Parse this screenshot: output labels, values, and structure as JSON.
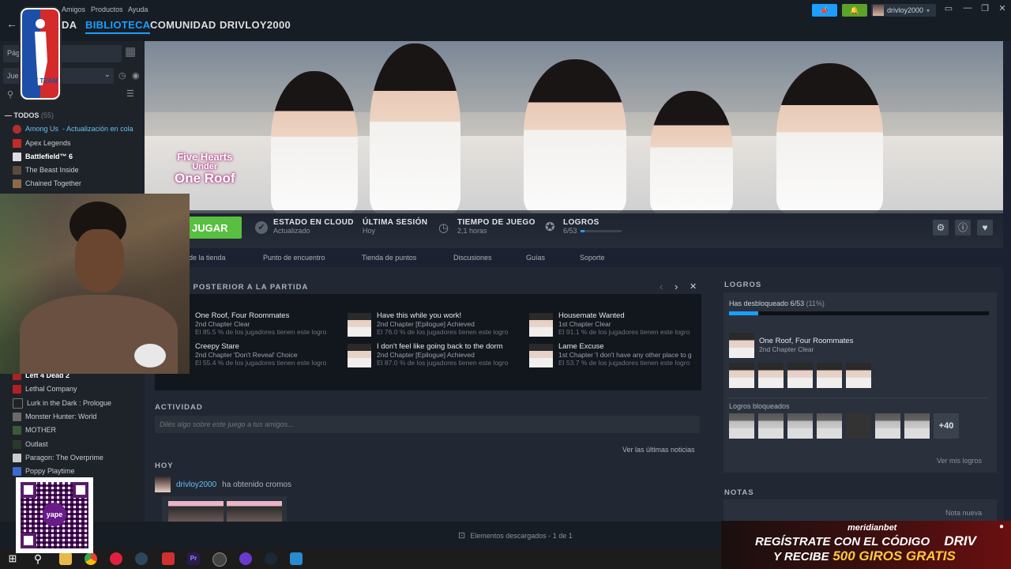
{
  "topbar": {
    "menu": [
      "Amigos",
      "Productos",
      "Ayuda"
    ],
    "nav": [
      "DA",
      "BIBLIOTECA",
      "COMUNIDAD",
      "DRIVLOY2000"
    ],
    "username": "drivloy2000",
    "accent": "#1a9fff"
  },
  "overlay_logo": {
    "text": "DRIV TEAM"
  },
  "sidebar": {
    "search_frag": "Pág",
    "filter_frag": "Jue",
    "all_label": "TODOS",
    "all_count": "(55)",
    "games": [
      {
        "name": "Among Us",
        "status": "- Actualización en cola",
        "color": "#66c0f4"
      },
      {
        "name": "Apex Legends",
        "status": "",
        "color": "#c8cdd2"
      },
      {
        "name": "Battlefield™ 6",
        "status": "",
        "color": "#ffffff"
      },
      {
        "name": "The Beast Inside",
        "status": "",
        "color": "#c8cdd2"
      },
      {
        "name": "Chained Together",
        "status": "",
        "color": "#c8cdd2"
      }
    ],
    "games_lower": [
      {
        "name": "Left 4 Dead 2"
      },
      {
        "name": "Lethal Company"
      },
      {
        "name": "Lurk in the Dark : Prologue"
      },
      {
        "name": "Monster Hunter: World"
      },
      {
        "name": "MOTHER"
      },
      {
        "name": "Outlast"
      },
      {
        "name": "Paragon: The Overprime"
      },
      {
        "name": "Poppy Playtime"
      }
    ]
  },
  "hero": {
    "game_title_line1": "Five Hearts",
    "game_title_line2": "Under",
    "game_title_line3": "One Roof"
  },
  "playbar": {
    "play_label": "JUGAR",
    "cloud_label": "ESTADO EN CLOUD",
    "cloud_value": "Actualizado",
    "session_label": "ÚLTIMA SESIÓN",
    "session_value": "Hoy",
    "playtime_label": "TIEMPO DE JUEGO",
    "playtime_value": "2,1 horas",
    "ach_label": "LOGROS",
    "ach_value": "6/53",
    "ach_fraction": 0.113
  },
  "subnav": [
    "de la tienda",
    "Punto de encuentro",
    "Tienda de puntos",
    "Discusiones",
    "Guías",
    "Soporte"
  ],
  "postgame": {
    "title": "N POSTERIOR A LA PARTIDA",
    "items": [
      {
        "title": "One Roof, Four Roommates",
        "sub": "2nd Chapter Clear",
        "pct": "El 85.5 % de los jugadores tienen este logro"
      },
      {
        "title": "Have this while you work!",
        "sub": "2nd Chapter [Epilogue] Achieved",
        "pct": "El 76.0 % de los jugadores tienen este logro"
      },
      {
        "title": "Housemate Wanted",
        "sub": "1st Chapter Clear",
        "pct": "El 91.1 % de los jugadores tienen este logro"
      },
      {
        "title": "Creepy Stare",
        "sub": "2nd Chapter 'Don't Reveal' Choice",
        "pct": "El 55.4 % de los jugadores tienen este logro"
      },
      {
        "title": "I don't feel like going back to the dorm",
        "sub": "2nd Chapter [Epilogue] Achieved",
        "pct": "El 87.0 % de los jugadores tienen este logro"
      },
      {
        "title": "Lame Excuse",
        "sub": "1st Chapter 'I don't have any other place to g",
        "pct": "El 53.7 % de los jugadores tienen este logro"
      }
    ]
  },
  "activity": {
    "title": "ACTIVIDAD",
    "placeholder": "Dilés algo sobre este juego a tus amigos...",
    "news_link": "Ver las últimas noticias",
    "today": "HOY",
    "event_user": "drivloy2000",
    "event_text": "ha obtenido cromos"
  },
  "achievements_panel": {
    "title": "LOGROS",
    "unlocked_text": "Has desbloqueado 6/53",
    "unlocked_pct": "(11%)",
    "progress_fraction": 0.113,
    "featured_title": "One Roof, Four Roommates",
    "featured_sub": "2nd Chapter Clear",
    "locked_title": "Logros bloqueados",
    "locked_more": "+40",
    "view_link": "Ver mis logros",
    "notes_title": "NOTAS",
    "notes_new": "Nota nueva"
  },
  "statusbar": {
    "downloads": "Elementos descargados - 1 de 1"
  },
  "ad": {
    "brand": "meridianbet",
    "line1": "REGÍSTRATE CON EL CÓDIGO",
    "code": "DRIV",
    "line2a": "Y RECIBE",
    "line2b": "500 GIROS GRATIS"
  },
  "qr": {
    "label": "yape"
  }
}
